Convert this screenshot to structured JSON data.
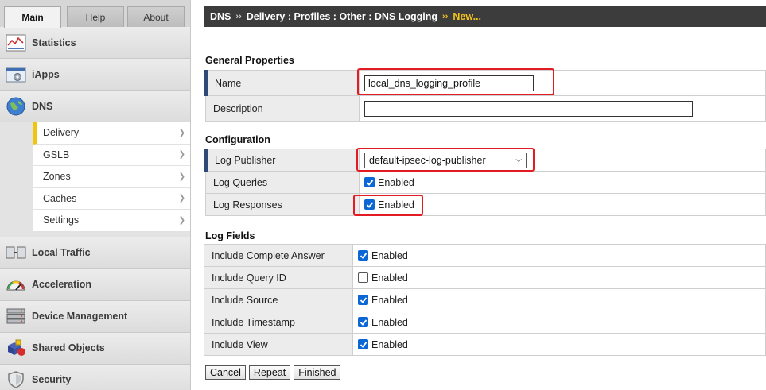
{
  "nav_tabs": [
    {
      "label": "Main",
      "active": true
    },
    {
      "label": "Help",
      "active": false
    },
    {
      "label": "About",
      "active": false
    }
  ],
  "nav_sections_top": [
    {
      "label": "Statistics",
      "icon": "statistics-icon"
    },
    {
      "label": "iApps",
      "icon": "iapps-icon"
    },
    {
      "label": "DNS",
      "icon": "dns-globe-icon"
    }
  ],
  "dns_subnav": [
    {
      "label": "Delivery",
      "active": true
    },
    {
      "label": "GSLB",
      "active": false
    },
    {
      "label": "Zones",
      "active": false
    },
    {
      "label": "Caches",
      "active": false
    },
    {
      "label": "Settings",
      "active": false
    }
  ],
  "nav_sections_bottom": [
    {
      "label": "Local Traffic",
      "icon": "local-traffic-icon"
    },
    {
      "label": "Acceleration",
      "icon": "acceleration-gauge-icon"
    },
    {
      "label": "Device Management",
      "icon": "device-management-icon"
    },
    {
      "label": "Shared Objects",
      "icon": "shared-objects-icon"
    },
    {
      "label": "Security",
      "icon": "security-shield-icon"
    }
  ],
  "breadcrumb": {
    "items": [
      "DNS",
      "Delivery : Profiles : Other : DNS Logging"
    ],
    "current": "New..."
  },
  "general_properties": {
    "title": "General Properties",
    "name_label": "Name",
    "name_value": "local_dns_logging_profile",
    "description_label": "Description",
    "description_value": ""
  },
  "configuration": {
    "title": "Configuration",
    "log_publisher_label": "Log Publisher",
    "log_publisher_value": "default-ipsec-log-publisher",
    "log_queries_label": "Log Queries",
    "log_queries_checked": true,
    "log_responses_label": "Log Responses",
    "log_responses_checked": true,
    "enabled_text": "Enabled"
  },
  "log_fields": {
    "title": "Log Fields",
    "rows": [
      {
        "label": "Include Complete Answer",
        "checked": true,
        "text": "Enabled"
      },
      {
        "label": "Include Query ID",
        "checked": false,
        "text": "Enabled"
      },
      {
        "label": "Include Source",
        "checked": true,
        "text": "Enabled"
      },
      {
        "label": "Include Timestamp",
        "checked": true,
        "text": "Enabled"
      },
      {
        "label": "Include View",
        "checked": true,
        "text": "Enabled"
      }
    ]
  },
  "buttons": {
    "cancel": "Cancel",
    "repeat": "Repeat",
    "finished": "Finished"
  },
  "colors": {
    "highlight": "#e31b23",
    "checkbox_checked": "#0b66d6",
    "breadcrumb_bg": "#3c3c3c",
    "breadcrumb_current": "#f5c518",
    "required_marker": "#2f4a78",
    "active_subnav_marker": "#f1c40f"
  }
}
